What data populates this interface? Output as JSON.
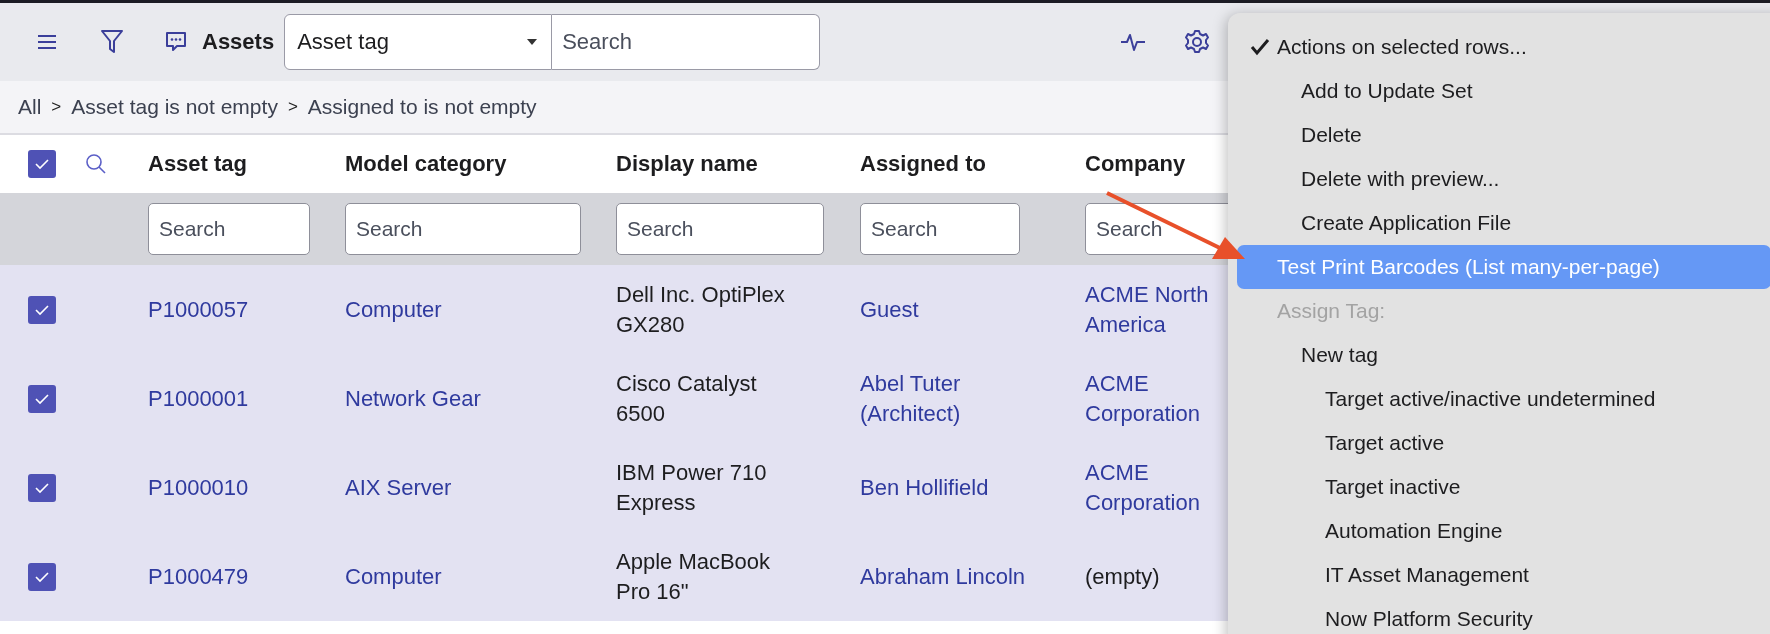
{
  "toolbar": {
    "title": "Assets",
    "field_select": {
      "value": "Asset tag"
    },
    "search": {
      "placeholder": "Search"
    }
  },
  "breadcrumbs": {
    "separator": ">",
    "items": [
      "All",
      "Asset tag is not empty",
      "Assigned to is not empty"
    ]
  },
  "table": {
    "all_selected": true,
    "columns": [
      {
        "label": "Asset tag",
        "filter_placeholder": "Search"
      },
      {
        "label": "Model category",
        "filter_placeholder": "Search"
      },
      {
        "label": "Display name",
        "filter_placeholder": "Search"
      },
      {
        "label": "Assigned to",
        "filter_placeholder": "Search"
      },
      {
        "label": "Company",
        "filter_placeholder": "Search"
      }
    ],
    "rows": [
      {
        "selected": true,
        "cells": [
          {
            "text": "P1000057",
            "link": true
          },
          {
            "text": "Computer",
            "link": true
          },
          {
            "text": "Dell Inc. OptiPlex GX280",
            "link": false
          },
          {
            "text": "Guest",
            "link": true
          },
          {
            "text": "ACME North America",
            "link": true
          }
        ]
      },
      {
        "selected": true,
        "cells": [
          {
            "text": "P1000001",
            "link": true
          },
          {
            "text": "Network Gear",
            "link": true
          },
          {
            "text": "Cisco Catalyst 6500",
            "link": false
          },
          {
            "text": "Abel Tuter (Architect)",
            "link": true
          },
          {
            "text": "ACME Corporation",
            "link": true
          }
        ]
      },
      {
        "selected": true,
        "cells": [
          {
            "text": "P1000010",
            "link": true
          },
          {
            "text": "AIX Server",
            "link": true
          },
          {
            "text": "IBM Power 710 Express",
            "link": false
          },
          {
            "text": "Ben Hollifield",
            "link": true
          },
          {
            "text": "ACME Corporation",
            "link": true
          }
        ]
      },
      {
        "selected": true,
        "cells": [
          {
            "text": "P1000479",
            "link": true
          },
          {
            "text": "Computer",
            "link": true
          },
          {
            "text": "Apple MacBook Pro 16\"",
            "link": false
          },
          {
            "text": "Abraham Lincoln",
            "link": true
          },
          {
            "text": "(empty)",
            "link": false
          }
        ]
      }
    ]
  },
  "context_menu": {
    "items": [
      {
        "label": "Actions on selected rows...",
        "checked": true,
        "selected": false,
        "disabled": false,
        "children": [
          {
            "label": "Add to Update Set",
            "checked": false,
            "selected": false,
            "disabled": false
          },
          {
            "label": "Delete",
            "checked": false,
            "selected": false,
            "disabled": false
          },
          {
            "label": "Delete with preview...",
            "checked": false,
            "selected": false,
            "disabled": false
          },
          {
            "label": "Create Application File",
            "checked": false,
            "selected": false,
            "disabled": false
          }
        ]
      },
      {
        "label": "Test Print Barcodes (List many-per-page)",
        "checked": false,
        "selected": true,
        "disabled": false
      },
      {
        "label": "Assign Tag:",
        "checked": false,
        "selected": false,
        "disabled": true,
        "children": [
          {
            "label": "New tag",
            "checked": false,
            "selected": false,
            "disabled": false,
            "children": [
              {
                "label": "Target active/inactive undetermined",
                "checked": false,
                "selected": false,
                "disabled": false
              },
              {
                "label": "Target active",
                "checked": false,
                "selected": false,
                "disabled": false
              },
              {
                "label": "Target inactive",
                "checked": false,
                "selected": false,
                "disabled": false
              },
              {
                "label": "Automation Engine",
                "checked": false,
                "selected": false,
                "disabled": false
              },
              {
                "label": "IT Asset Management",
                "checked": false,
                "selected": false,
                "disabled": false
              },
              {
                "label": "Now Platform Security",
                "checked": false,
                "selected": false,
                "disabled": false
              }
            ]
          }
        ]
      }
    ]
  }
}
